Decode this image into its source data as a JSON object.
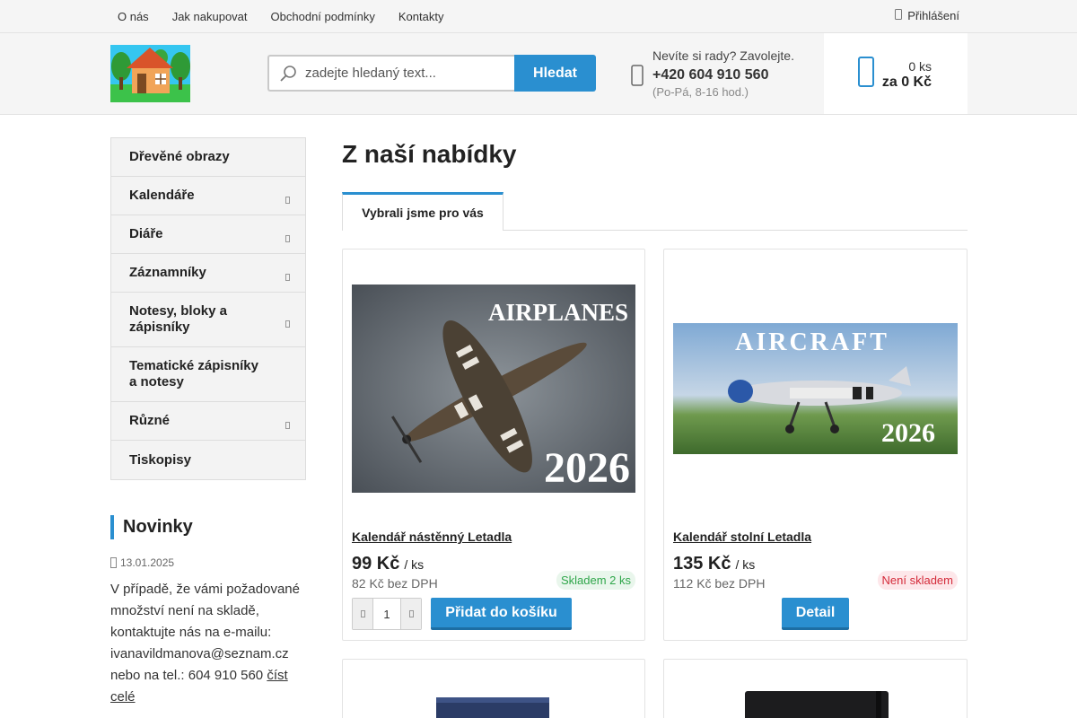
{
  "topbar": {
    "links": [
      "O nás",
      "Jak nakupovat",
      "Obchodní podmínky",
      "Kontakty"
    ],
    "login": "Přihlášení"
  },
  "header": {
    "search_placeholder": "zadejte hledaný text...",
    "search_button": "Hledat",
    "contact_prompt": "Nevíte si rady? Zavolejte.",
    "contact_phone": "+420 604 910 560",
    "contact_hours": "(Po-Pá, 8-16 hod.)",
    "cart_qty": "0 ks",
    "cart_price": "za 0 Kč"
  },
  "categories": [
    {
      "label": "Dřevěné obrazy",
      "has_sub": false
    },
    {
      "label": "Kalendáře",
      "has_sub": true
    },
    {
      "label": "Diáře",
      "has_sub": true
    },
    {
      "label": "Záznamníky",
      "has_sub": true
    },
    {
      "label": "Notesy, bloky a zápisníky",
      "has_sub": true
    },
    {
      "label": "Tematické zápisníky a notesy",
      "has_sub": false
    },
    {
      "label": "Různé",
      "has_sub": true
    },
    {
      "label": "Tiskopisy",
      "has_sub": false
    }
  ],
  "news": {
    "title": "Novinky",
    "date": "13.01.2025",
    "text": "V případě, že vámi požadované množství není na skladě, kontaktujte nás na e-mailu: ivanavildmanova@seznam.cz nebo na tel.: 604 910 560",
    "read_more": "číst celé"
  },
  "main": {
    "title": "Z naší nabídky",
    "tab": "Vybrali jsme pro vás"
  },
  "products": [
    {
      "name": "Kalendář nástěnný Letadla",
      "price": "99 Kč",
      "unit": "/ ks",
      "net": "82 Kč bez DPH",
      "stock": "Skladem 2 ks",
      "qty": "1",
      "button": "Přidat do košíku",
      "img_title": "AIRPLANES",
      "img_year": "2026"
    },
    {
      "name": "Kalendář stolní Letadla",
      "price": "135 Kč",
      "unit": "/ ks",
      "net": "112 Kč bez DPH",
      "stock": "Není skladem",
      "button": "Detail",
      "img_title": "AIRCRAFT",
      "img_year": "2026"
    }
  ],
  "colors": {
    "accent": "#2a8fd0",
    "in_stock": "#2fa64a",
    "out_of_stock": "#d42b3a"
  }
}
